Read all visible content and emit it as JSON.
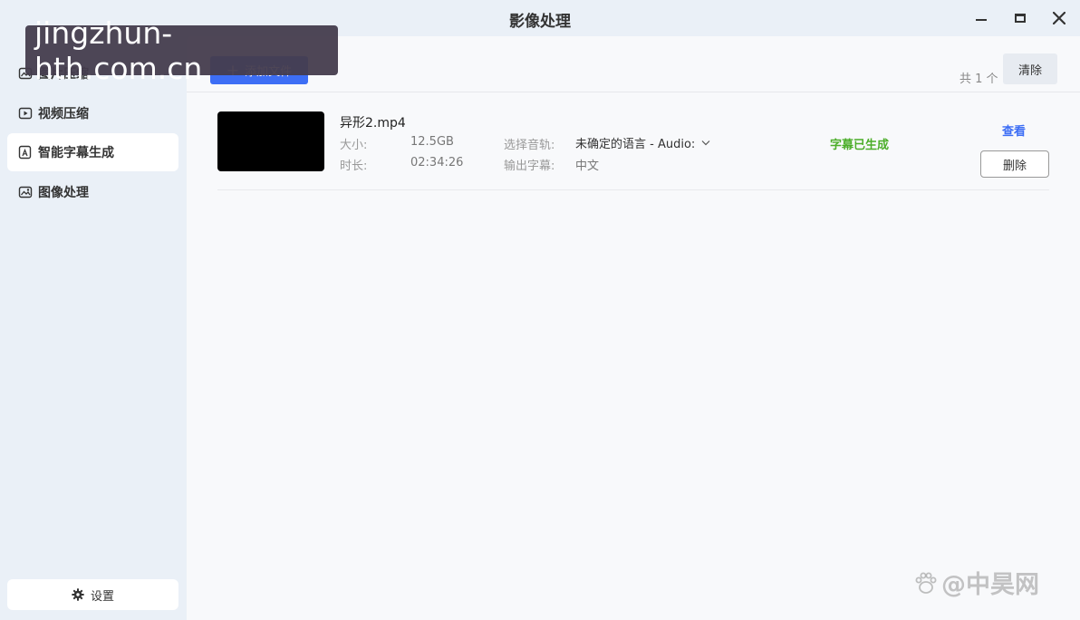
{
  "window": {
    "title": "影像处理"
  },
  "sidebar": {
    "items": [
      {
        "label": "图片压缩",
        "icon": "image-compress-icon",
        "active": false
      },
      {
        "label": "视频压缩",
        "icon": "video-compress-icon",
        "active": false
      },
      {
        "label": "智能字幕生成",
        "icon": "subtitle-icon",
        "active": true
      },
      {
        "label": "图像处理",
        "icon": "image-process-icon",
        "active": false
      }
    ],
    "settings_label": "设置"
  },
  "toolbar": {
    "add_label": "添加文件",
    "count_text": "共 1 个",
    "clear_label": "清除"
  },
  "files": [
    {
      "name": "异形2.mp4",
      "size_label": "大小:",
      "size": "12.5GB",
      "duration_label": "时长:",
      "duration": "02:34:26",
      "track_label": "选择音轨:",
      "track_value": "未确定的语言 - Audio:",
      "output_label": "输出字幕:",
      "output_value": "中文",
      "status": "字幕已生成",
      "view_label": "查看",
      "delete_label": "删除"
    }
  ],
  "watermarks": {
    "url": "jingzhun-hth.com.cn",
    "logo": "@中昊网"
  },
  "colors": {
    "accent": "#3d6ef5",
    "success": "#4cae2a",
    "background": "#eaf0f7"
  }
}
